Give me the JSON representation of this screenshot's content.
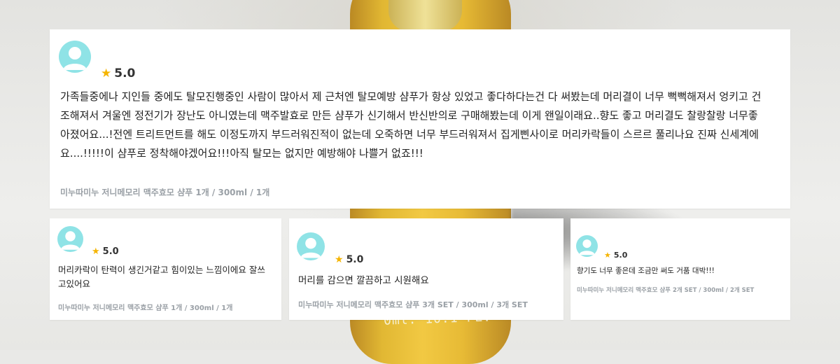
{
  "reviews": [
    {
      "rating": "5.0",
      "text": "가족들중에나 지인들 중에도 탈모진행중인 사람이 많아서 제 근처엔 탈모예방 샴푸가 항상 있었고 좋다하다는건 다 써봤는데 머리결이 너무 뻑뻑해져서 엉키고 건조해져서 겨울엔 정전기가 장난도 아니였는데 맥주발효로 만든 샴푸가 신기해서 반신반의로 구매해봤는데 이게 왠일이래요..향도 좋고 머리결도 찰랑찰랑 너무좋아졌어요...!전엔 트리트먼트를 해도 이정도까지 부드러워진적이 없는데 오죽하면 너무 부드러워져서 집게삔사이로 머리카락들이 스르르 풀리나요 진짜 신세계에요....!!!!!이 샴푸로 정착해야겠어요!!!아직 탈모는 없지만 예방해야 나쁠거 없죠!!!",
      "product": "미누따미누 저니메모리 맥주효모 샴푸 1개 / 300ml / 1개"
    },
    {
      "rating": "5.0",
      "text": "머리카락이 탄력이 생긴거같고 힘이있는 느낌이에요 잘쓰고있어요",
      "product": "미누따미누 저니메모리 맥주효모 샴푸 1개 / 300ml / 1개"
    },
    {
      "rating": "5.0",
      "text": "머리를 감으면 깔끔하고 시원해요",
      "product": "미누따미누 저니메모리 맥주효모 샴푸 3개 SET / 300ml / 3개 SET"
    },
    {
      "rating": "5.0",
      "text": "향기도 너무 좋은데 조금만 써도 거품 대박!!!",
      "product": "미누따미누 저니메모리 맥주효모 샴푸 2개 SET / 300ml / 2개 SET"
    }
  ],
  "background": {
    "bottle_label": "0ml. 10.1 FL."
  },
  "colors": {
    "star": "#f5b400",
    "avatar": "#8fe3e6",
    "meta_text": "#9aa0a6"
  }
}
